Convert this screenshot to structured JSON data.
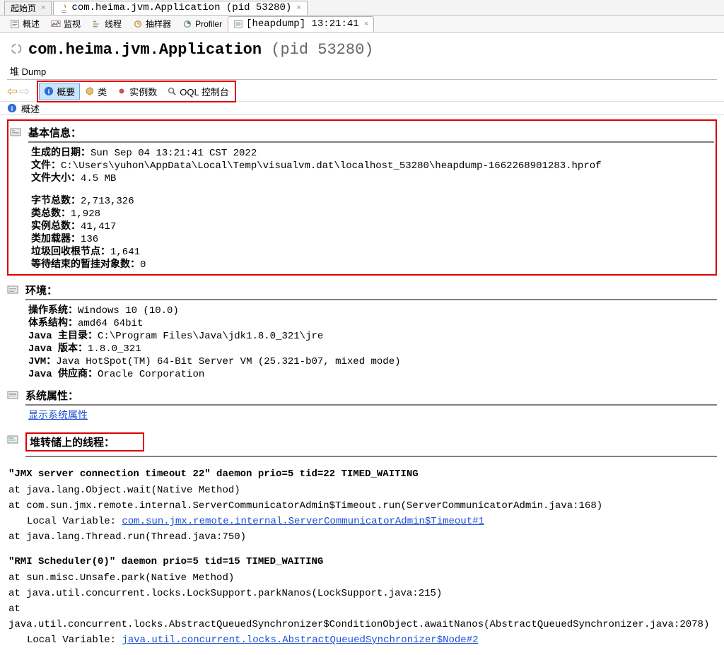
{
  "outer_tabs": {
    "start": "起始页",
    "app": "com.heima.jvm.Application (pid 53280)"
  },
  "inner_tabs": {
    "overview": "概述",
    "monitor": "监视",
    "threads": "线程",
    "sampler": "抽样器",
    "profiler": "Profiler",
    "heapdump": "[heapdump] 13:21:41"
  },
  "title": {
    "app": "com.heima.jvm.Application",
    "pid": "(pid 53280)"
  },
  "dump_label": "堆 Dump",
  "nav": {
    "summary": "概要",
    "classes": "类",
    "instances": "实例数",
    "oql": "OQL 控制台"
  },
  "crumb": "概述",
  "basic": {
    "title": "基本信息：",
    "date_lbl": "生成的日期：",
    "date_val": "Sun Sep 04 13:21:41 CST 2022",
    "file_lbl": "文件：",
    "file_val": "C:\\Users\\yuhon\\AppData\\Local\\Temp\\visualvm.dat\\localhost_53280\\heapdump-1662268901283.hprof",
    "size_lbl": "文件大小：",
    "size_val": "4.5 MB",
    "bytes_lbl": "字节总数：",
    "bytes_val": "2,713,326",
    "classes_lbl": "类总数：",
    "classes_val": "1,928",
    "inst_lbl": "实例总数：",
    "inst_val": "41,417",
    "loaders_lbl": "类加载器：",
    "loaders_val": "136",
    "gcroots_lbl": "垃圾回收根节点：",
    "gcroots_val": "1,641",
    "pending_lbl": "等待结束的暂挂对象数：",
    "pending_val": "0"
  },
  "env": {
    "title": "环境：",
    "os_lbl": "操作系统：",
    "os_val": "Windows 10 (10.0)",
    "arch_lbl": "体系结构：",
    "arch_val": "amd64 64bit",
    "home_lbl": "Java 主目录：",
    "home_val": "C:\\Program Files\\Java\\jdk1.8.0_321\\jre",
    "ver_lbl": "Java 版本：",
    "ver_val": "1.8.0_321",
    "jvm_lbl": "JVM：",
    "jvm_val": "Java HotSpot(TM) 64-Bit Server VM (25.321-b07, mixed mode)",
    "vendor_lbl": "Java 供应商：",
    "vendor_val": "Oracle Corporation"
  },
  "sysprops": {
    "title": "系统属性：",
    "link": "显示系统属性"
  },
  "threads_sec": {
    "title": "堆转储上的线程："
  },
  "thread1": {
    "title": "\"JMX server connection timeout 22\" daemon prio=5 tid=22 TIMED_WAITING",
    "l1": "at java.lang.Object.wait(Native Method)",
    "l2": "at com.sun.jmx.remote.internal.ServerCommunicatorAdmin$Timeout.run(ServerCommunicatorAdmin.java:168)",
    "lv_pre": "Local Variable: ",
    "lv_link": "com.sun.jmx.remote.internal.ServerCommunicatorAdmin$Timeout#1",
    "l3": "at java.lang.Thread.run(Thread.java:750)"
  },
  "thread2": {
    "title": "\"RMI Scheduler(0)\" daemon prio=5 tid=15 TIMED_WAITING",
    "l1": "at sun.misc.Unsafe.park(Native Method)",
    "l2": "at java.util.concurrent.locks.LockSupport.parkNanos(LockSupport.java:215)",
    "l3": "at java.util.concurrent.locks.AbstractQueuedSynchronizer$ConditionObject.awaitNanos(AbstractQueuedSynchronizer.java:2078)",
    "lv_pre": "Local Variable: ",
    "lv_link": "java.util.concurrent.locks.AbstractQueuedSynchronizer$Node#2"
  }
}
